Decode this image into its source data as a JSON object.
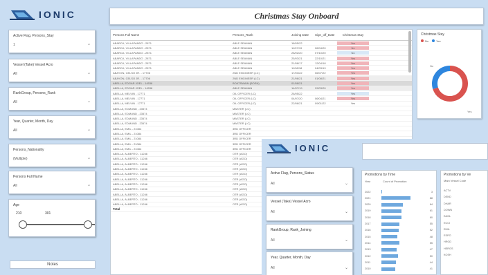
{
  "brand": {
    "name": "IONIC"
  },
  "dashboard": {
    "title": "Christmas Stay Onboard"
  },
  "slicers": [
    {
      "label": "Active Flag, Persons_Stay",
      "value": "1"
    },
    {
      "label": "Vessel (Take) Vessel Acro",
      "value": "All"
    },
    {
      "label": "RankGroup, Persons_Rank",
      "value": "All"
    },
    {
      "label": "Year, Quarter, Month, Day",
      "value": "All"
    },
    {
      "label": "Persons_Nationality",
      "value": "(Multiple)"
    },
    {
      "label": "Persons Full Name",
      "value": "All"
    }
  ],
  "range_slicer": {
    "label": "Age",
    "min": "210",
    "max": "301"
  },
  "notes_button": "Notes",
  "table": {
    "columns": [
      "Persons Full Name",
      "Persons_Rank",
      "Joining Date",
      "Sign_off_Date",
      "Christmas Stay"
    ],
    "rows": [
      {
        "name": "ABARCA, VILLAPANDO  - 2871",
        "rank": "ABLE SEAMAN",
        "join": "18/05/22",
        "off": "",
        "stay": "Yes",
        "hl": "pink",
        "tone": ""
      },
      {
        "name": "ABARCA, VILLAPANDO  - 2871",
        "rank": "ABLE SEAMAN",
        "join": "11/07/19",
        "off": "06/04/20",
        "stay": "No",
        "hl": "pink",
        "tone": ""
      },
      {
        "name": "ABARCA, VILLAPANDO  - 2871",
        "rank": "ABLE SEAMAN",
        "join": "28/02/20",
        "off": "07/10/20",
        "stay": "No",
        "hl": "blue",
        "tone": ""
      },
      {
        "name": "ABARCA, VILLAPANDO  - 2871",
        "rank": "ABLE SEAMAN",
        "join": "25/03/21",
        "off": "22/10/21",
        "stay": "Yes",
        "hl": "pink",
        "tone": ""
      },
      {
        "name": "ABARCA, VILLAPANDO  - 2871",
        "rank": "ABLE SEAMAN",
        "join": "21/08/17",
        "off": "12/04/18",
        "stay": "Yes",
        "hl": "pink",
        "tone": ""
      },
      {
        "name": "ABARCA, VILLAPANDO  - 2871",
        "rank": "ABLE SEAMAN",
        "join": "11/08/18",
        "off": "04/03/19",
        "stay": "Yes",
        "hl": "pink",
        "tone": ""
      },
      {
        "name": "ABAYON, CELSO JR.  - 17706",
        "rank": "2ND ENGINEER (LC)",
        "join": "17/03/22",
        "off": "06/07/22",
        "stay": "Yes",
        "hl": "pink",
        "tone": ""
      },
      {
        "name": "ABAYON, CELSO JR.  - 17706",
        "rank": "2ND ENGINEER (LC)",
        "join": "21/06/21",
        "off": "01/08/21",
        "stay": "Yes",
        "hl": "pink",
        "tone": "shade"
      },
      {
        "name": "ABELLA, EDGAR JOEL  - 14538",
        "rank": "BOATSWAIN (BOSN)",
        "join": "01/08/21",
        "off": "",
        "stay": "Yes",
        "hl": "pink",
        "tone": "dark"
      },
      {
        "name": "ABELLA, EDGAR JOEL  - 14538",
        "rank": "ABLE SEAMAN",
        "join": "14/07/19",
        "off": "29/03/20",
        "stay": "Yes",
        "hl": "pink",
        "tone": "shade"
      },
      {
        "name": "ABELLA, MELVIN  - 17771",
        "rank": "OIL OFFICER (LC)",
        "join": "26/05/22",
        "off": "",
        "stay": "Yes",
        "hl": "blue",
        "tone": ""
      },
      {
        "name": "ABELLA, MELVIN  - 17771",
        "rank": "OIL OFFICER (LC)",
        "join": "04/07/20",
        "off": "06/04/21",
        "stay": "Yes",
        "hl": "pink",
        "tone": ""
      },
      {
        "name": "ABELLA, MELVIN  - 17771",
        "rank": "OIL OFFICER (LC)",
        "join": "22/06/21",
        "off": "09/01/22",
        "stay": "Yes",
        "hl": "",
        "tone": ""
      },
      {
        "name": "ABELLA, EDMUND  - 23574",
        "rank": "MASTER (LC)",
        "join": "",
        "off": "",
        "stay": "",
        "hl": "",
        "tone": ""
      },
      {
        "name": "ABELLA, EDMUND  - 23574",
        "rank": "MASTER (LC)",
        "join": "",
        "off": "",
        "stay": "",
        "hl": "",
        "tone": ""
      },
      {
        "name": "ABELLA, EDMUND  - 23574",
        "rank": "MASTER (LC)",
        "join": "",
        "off": "",
        "stay": "",
        "hl": "",
        "tone": ""
      },
      {
        "name": "ABELLA, EDMUND  - 23574",
        "rank": "MASTER (LC)",
        "join": "",
        "off": "",
        "stay": "",
        "hl": "",
        "tone": ""
      },
      {
        "name": "ABELLA, EMIL  - 21084",
        "rank": "3RD OFFICER",
        "join": "",
        "off": "",
        "stay": "",
        "hl": "",
        "tone": ""
      },
      {
        "name": "ABELLA, EMIL  - 21084",
        "rank": "3RD OFFICER",
        "join": "",
        "off": "",
        "stay": "",
        "hl": "",
        "tone": ""
      },
      {
        "name": "ABELLA, EMIL  - 21084",
        "rank": "3RD OFFICER",
        "join": "",
        "off": "",
        "stay": "",
        "hl": "",
        "tone": ""
      },
      {
        "name": "ABELLA, EMIL  - 21084",
        "rank": "3RD OFFICER",
        "join": "",
        "off": "",
        "stay": "",
        "hl": "",
        "tone": ""
      },
      {
        "name": "ABELLA, EMIL  - 21084",
        "rank": "3RD OFFICER",
        "join": "",
        "off": "",
        "stay": "",
        "hl": "",
        "tone": ""
      },
      {
        "name": "ABELLA, ALBERTO  - 11246",
        "rank": "OTR (AGO)",
        "join": "",
        "off": "",
        "stay": "",
        "hl": "",
        "tone": ""
      },
      {
        "name": "ABELLA, ALBERTO  - 11246",
        "rank": "OTR (AGO)",
        "join": "",
        "off": "",
        "stay": "",
        "hl": "",
        "tone": ""
      },
      {
        "name": "ABELLA, ALBERTO  - 11246",
        "rank": "OTR (AGO)",
        "join": "",
        "off": "",
        "stay": "",
        "hl": "",
        "tone": ""
      },
      {
        "name": "ABELLA, ALBERTO  - 11246",
        "rank": "OTR (AGO)",
        "join": "",
        "off": "",
        "stay": "",
        "hl": "",
        "tone": ""
      },
      {
        "name": "ABELLA, ALBERTO  - 11246",
        "rank": "OTR (AGO)",
        "join": "",
        "off": "",
        "stay": "",
        "hl": "",
        "tone": ""
      },
      {
        "name": "ABELLA, ALBERTO  - 11246",
        "rank": "OTR (AGO)",
        "join": "",
        "off": "",
        "stay": "",
        "hl": "",
        "tone": ""
      },
      {
        "name": "ABELLA, ALBERTO  - 11246",
        "rank": "OTR (AGO)",
        "join": "",
        "off": "",
        "stay": "",
        "hl": "",
        "tone": ""
      },
      {
        "name": "ABELLA, ALBERTO  - 11246",
        "rank": "OTR (AGO)",
        "join": "",
        "off": "",
        "stay": "",
        "hl": "",
        "tone": ""
      },
      {
        "name": "ABELLA, ALBERTO  - 11246",
        "rank": "OTR (AGO)",
        "join": "",
        "off": "",
        "stay": "",
        "hl": "",
        "tone": ""
      },
      {
        "name": "ABELLA, ALBERTO  - 11246",
        "rank": "OTR (AGO)",
        "join": "",
        "off": "",
        "stay": "",
        "hl": "",
        "tone": ""
      },
      {
        "name": "ABELLA, ALBERTO  - 11246",
        "rank": "OTR (AGO)",
        "join": "",
        "off": "",
        "stay": "",
        "hl": "",
        "tone": ""
      }
    ],
    "total_label": "Total"
  },
  "donut": {
    "title": "Christmas Stay",
    "legend": [
      {
        "label": "No",
        "color": "#d9534f"
      },
      {
        "label": "Yes",
        "color": "#2e86de"
      }
    ],
    "label_left": "No",
    "label_right": "Yes",
    "chart_data": {
      "type": "pie",
      "categories": [
        "No",
        "Yes"
      ],
      "values": [
        70,
        30
      ],
      "title": "Christmas Stay"
    }
  },
  "overlay": {
    "brand": "IONIC",
    "slicers": [
      {
        "label": "Active Flag, Persons_Status",
        "value": "All"
      },
      {
        "label": "Vessel (Take) Vessel Acro",
        "value": "All"
      },
      {
        "label": "RankGroup, Rank_Joining",
        "value": "All"
      },
      {
        "label": "Year, Quarter, Month, Day",
        "value": "All"
      }
    ],
    "promo_card": {
      "title": "Promotions by Time",
      "col1": "Year",
      "col2": "Count of Promotion",
      "chart_data": {
        "type": "bar",
        "categories": [
          "2022",
          "2021",
          "2020",
          "2019",
          "2018",
          "2017",
          "2016",
          "2015",
          "2014",
          "2013",
          "2012",
          "2011",
          "2010"
        ],
        "values": [
          3,
          88,
          64,
          61,
          60,
          55,
          52,
          48,
          55,
          47,
          50,
          44,
          41
        ]
      }
    },
    "promo2": {
      "title": "Promotions by Ve",
      "sub": "Main Vessel Code",
      "items": [
        "ACTV",
        "DEND",
        "DHAR",
        "DOWN",
        "EAGL",
        "ECCI",
        "EMIL",
        "ESPO",
        "HRGD",
        "HERGS",
        "KOSH"
      ]
    }
  }
}
